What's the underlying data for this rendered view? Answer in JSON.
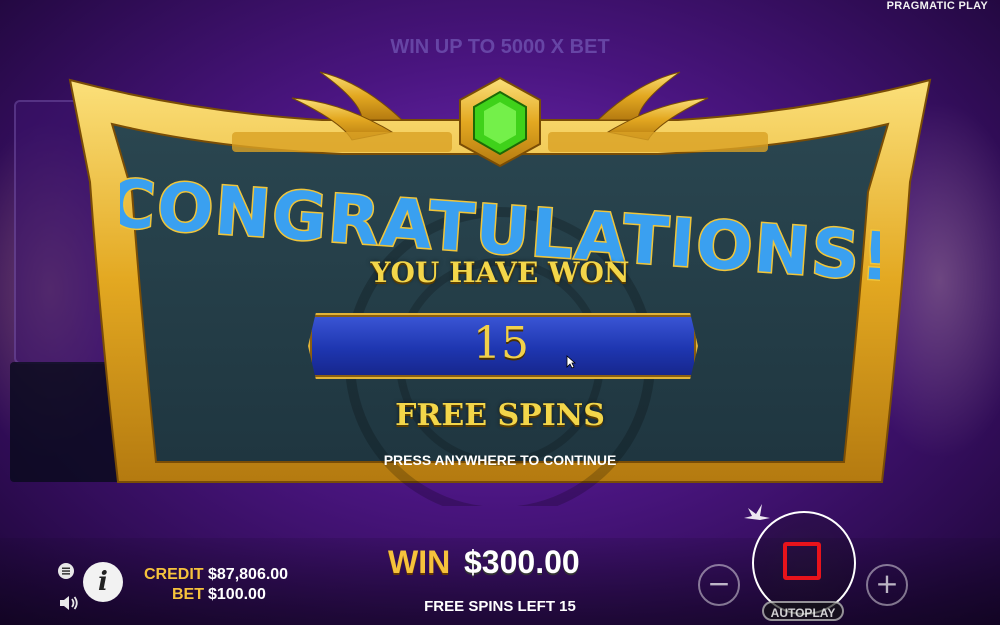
{
  "header": {
    "brand": "PRAGMATIC PLAY",
    "win_up": "WIN UP TO 5000 X BET"
  },
  "popup": {
    "title": "CONGRATULATIONS!",
    "won_label": "YOU HAVE WON",
    "count": "15",
    "free_spins_label": "FREE SPINS",
    "continue_hint": "PRESS ANYWHERE TO CONTINUE",
    "gem_color": "#3fd21a",
    "frame_color": "#e9b52e",
    "title_color": "#3aa0f0"
  },
  "bottom": {
    "credit_label": "CREDIT",
    "credit_value": "$87,806.00",
    "bet_label": "BET",
    "bet_value": "$100.00",
    "win_label": "WIN",
    "win_value": "$300.00",
    "free_spins_left": "FREE SPINS LEFT 15",
    "autoplay_label": "AUTOPLAY",
    "minus_symbol": "−",
    "plus_symbol": "+",
    "info_symbol": "i"
  }
}
